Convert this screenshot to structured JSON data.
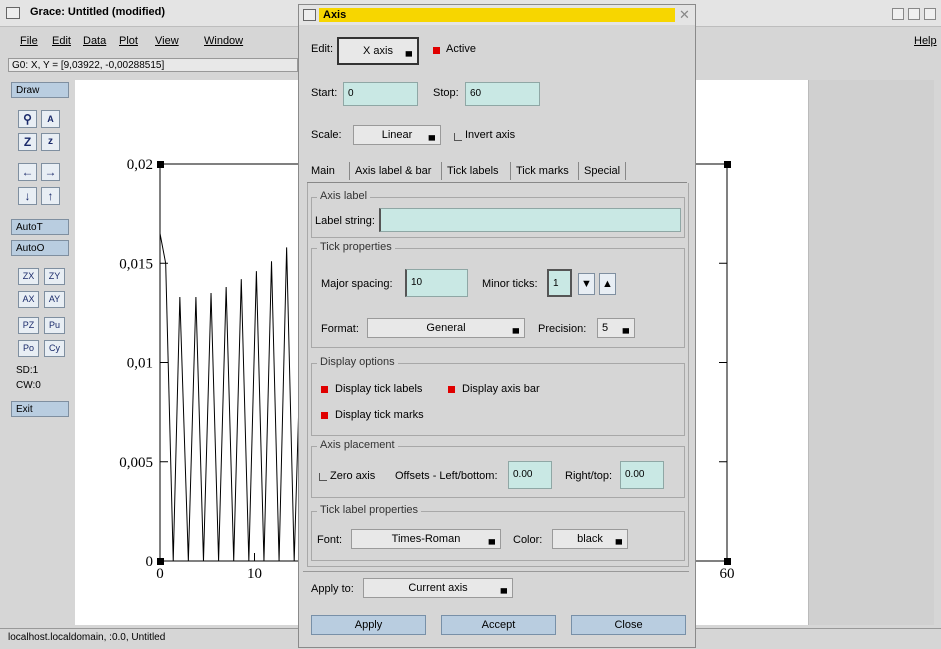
{
  "main": {
    "title": "Grace: Untitled (modified)",
    "menus": [
      "File",
      "Edit",
      "Data",
      "Plot",
      "View",
      "Window"
    ],
    "help": "Help",
    "coord": "G0: X, Y = [9,03922, -0,00288515]",
    "status": "localhost.localdomain, :0.0, Untitled",
    "sd": "SD:1",
    "cw": "CW:0",
    "toolbar": {
      "draw": "Draw",
      "autot": "AutoT",
      "autoo": "AutoO",
      "zx": "ZX",
      "zy": "ZY",
      "ax": "AX",
      "ay": "AY",
      "pz": "PZ",
      "pu": "Pu",
      "po": "Po",
      "cy": "Cy",
      "exit": "Exit"
    }
  },
  "chart_data": {
    "type": "line",
    "x_ticks": [
      "0",
      "10",
      "60"
    ],
    "y_ticks": [
      "0",
      "0,005",
      "0,01",
      "0,015",
      "0,02"
    ],
    "xlim": [
      0,
      60
    ],
    "ylim": [
      0,
      0.02
    ],
    "series": [
      {
        "x": [
          0,
          0.6,
          1.4,
          2.1,
          3.0,
          3.8,
          4.6,
          5.4,
          6.2,
          7.0,
          7.8,
          8.6,
          9.4,
          10.2,
          11.0,
          11.8,
          12.6,
          13.4,
          14.2,
          15.0,
          15.8,
          16.6,
          17.4,
          18.2,
          19.0,
          19.8,
          20.6,
          21.4,
          22.2,
          23.0,
          23.8
        ],
        "y": [
          0.0165,
          0.015,
          0.0,
          0.0133,
          0.0,
          0.0133,
          0.0,
          0.0135,
          0.0,
          0.0138,
          0.0,
          0.0142,
          0.0,
          0.0146,
          0.0,
          0.0151,
          0.0,
          0.0158,
          0.0,
          0.0127,
          0.0,
          0.0127,
          0.0,
          0.0127,
          0.0,
          0.0127,
          0.0,
          0.0127,
          0.0,
          0.0127,
          0.0
        ]
      }
    ]
  },
  "dialog": {
    "title": "Axis",
    "edit_label": "Edit:",
    "edit_value": "X axis",
    "active_label": "Active",
    "start_label": "Start:",
    "start_value": "0",
    "stop_label": "Stop:",
    "stop_value": "60",
    "scale_label": "Scale:",
    "scale_value": "Linear",
    "invert_label": "Invert axis",
    "tabs": [
      "Main",
      "Axis label & bar",
      "Tick labels",
      "Tick marks",
      "Special"
    ],
    "axis_label_group": "Axis label",
    "label_string_label": "Label string:",
    "label_string_value": "",
    "tick_props_group": "Tick properties",
    "major_spacing_label": "Major spacing:",
    "major_spacing_value": "10",
    "minor_ticks_label": "Minor ticks:",
    "minor_ticks_value": "1",
    "format_label": "Format:",
    "format_value": "General",
    "precision_label": "Precision:",
    "precision_value": "5",
    "display_group": "Display options",
    "display_tick_labels": "Display tick labels",
    "display_axis_bar": "Display axis bar",
    "display_tick_marks": "Display tick marks",
    "placement_group": "Axis placement",
    "zero_axis_label": "Zero axis",
    "offsets_label": "Offsets - Left/bottom:",
    "left_bottom_value": "0.00",
    "right_top_label": "Right/top:",
    "right_top_value": "0.00",
    "tick_label_props_group": "Tick label properties",
    "font_label": "Font:",
    "font_value": "Times-Roman",
    "color_label": "Color:",
    "color_value": "black",
    "apply_to_label": "Apply to:",
    "apply_to_value": "Current axis",
    "apply_button": "Apply",
    "accept_button": "Accept",
    "close_button": "Close"
  },
  "colors": {
    "active_title": "#f7d600",
    "field_bg": "#c9e8e4",
    "button_bg": "#b9cde0",
    "check_red": "#e00000"
  },
  "icons": [
    "window-menu-icon",
    "zoom-icon",
    "autoscale-icon",
    "arrow-left-icon",
    "arrow-right-icon",
    "arrow-down-icon",
    "arrow-up-icon",
    "close-icon",
    "spin-down-icon",
    "spin-up-icon"
  ]
}
